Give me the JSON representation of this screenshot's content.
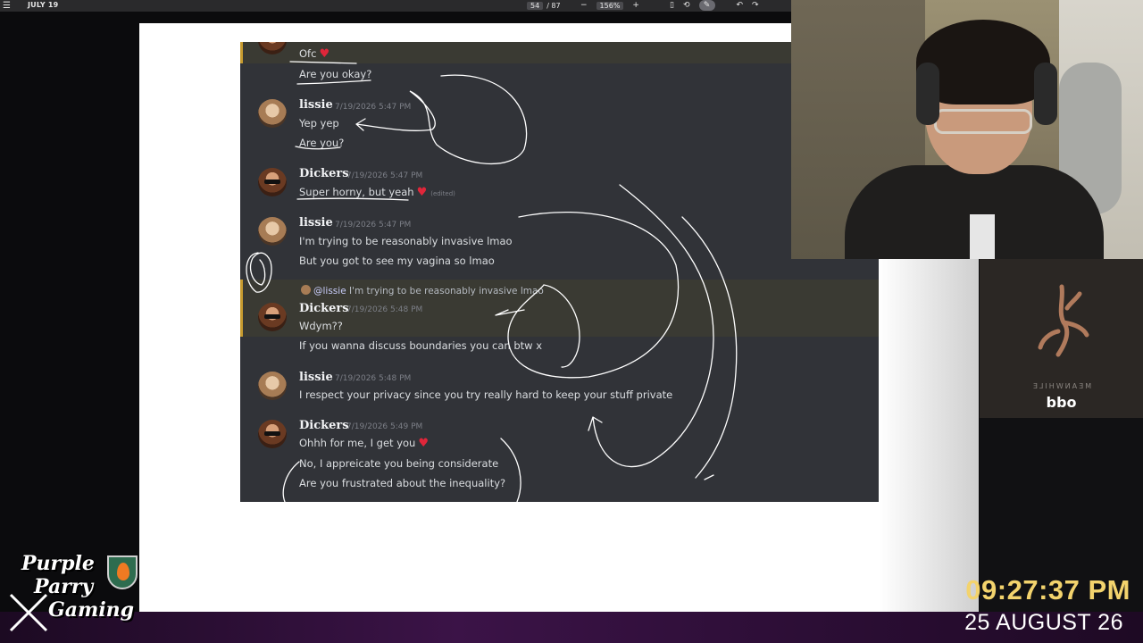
{
  "toolbar": {
    "menu_icon": "☰",
    "title": "JULY 19",
    "page_current": "54",
    "page_total": "/ 87",
    "zoom_out": "−",
    "zoom_level": "156%",
    "zoom_in": "+",
    "fit_icon": "▯",
    "rotate_icon": "⟲",
    "draw_icon": "✎",
    "undo_icon": "↶",
    "redo_icon": "↷"
  },
  "chat": {
    "messages": [
      {
        "text": "Ofc"
      },
      {
        "text": "Are you okay?"
      },
      {
        "user": "lissie",
        "time": "7/19/2026 5:47 PM",
        "lines": [
          "Yep yep",
          "Are you?"
        ]
      },
      {
        "user": "Dickers",
        "time": "7/19/2026 5:47 PM",
        "lines": [
          "Super horny, but yeah"
        ],
        "edited": "(edited)"
      },
      {
        "user": "lissie",
        "time": "7/19/2026 5:47 PM",
        "lines": [
          "I'm trying to be reasonably invasive lmao",
          "But you got to see my vagina so lmao"
        ]
      },
      {
        "reply_to": "@lissie",
        "reply_text": "I'm trying to be reasonably invasive lmao",
        "user": "Dickers",
        "time": "7/19/2026 5:48 PM",
        "lines": [
          "Wdym??",
          "If you wanna discuss boundaries you can btw x"
        ]
      },
      {
        "user": "lissie",
        "time": "7/19/2026 5:48 PM",
        "lines": [
          "I respect your privacy since you try really hard to keep your stuff private"
        ]
      },
      {
        "user": "Dickers",
        "time": "7/19/2026 5:49 PM",
        "lines": [
          "Ohhh for me, I get you",
          "No, I appreicate you being considerate",
          "Are you frustrated about the inequality?"
        ]
      }
    ],
    "heart": "♥"
  },
  "album": {
    "subtitle": "MEANWHILE",
    "title": "odd"
  },
  "clock": {
    "time": "09:27:37 PM",
    "date": "25 AUGUST 26"
  },
  "logo": {
    "line1": "Purple",
    "line2": "Parry",
    "line3": "Gaming"
  },
  "colors": {
    "accent_clock": "#f3d36d",
    "heart": "#e0263a",
    "highlight_bar": "#c79b2f",
    "chat_bg": "#313338",
    "bottom_bar": "#3b1347"
  }
}
